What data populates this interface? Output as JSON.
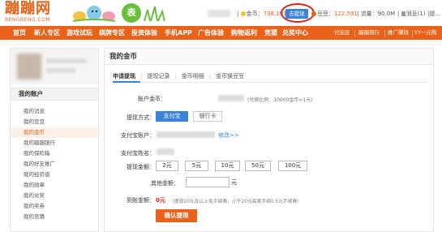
{
  "brand": {
    "name": "蹦蹦网",
    "domain": "BENGBENG.COM",
    "badge": "表"
  },
  "user_bar": {
    "coins_label": "金币：",
    "coins_value": "738,191",
    "withdraw_label": "去提现",
    "beans_label": "豆豆：",
    "beans_value": "122,591",
    "traffic_label": "流量：",
    "traffic_value": "90.0M",
    "message_label": "消息(1)",
    "separator": "|",
    "extra": "提..."
  },
  "nav": {
    "items": [
      "首页",
      "新人专区",
      "游戏试玩",
      "棋牌专区",
      "投资体验",
      "手机APP",
      "广告体验",
      "购物返利",
      "竞猜",
      "兑奖中心"
    ],
    "right_items": [
      "讨论区",
      "蹦蹦银行",
      "推广赚钱",
      "YY一元购"
    ]
  },
  "sidebar": {
    "title": "我的账户",
    "items": [
      "我的消息",
      "我的豆豆",
      "我的金币",
      "我的蹦蹦银行",
      "我的保险箱",
      "我的好友推广",
      "我的经验值",
      "我的勋章",
      "我的兑奖",
      "我的奖券",
      "我的竞猜"
    ],
    "active_index": 2
  },
  "main": {
    "title": "我的金币",
    "tabs": [
      "申请提现",
      "提现记录",
      "金币明细",
      "金币换豆豆"
    ],
    "active_tab": 0,
    "form": {
      "account_coins_label": "账户金币：",
      "ratio_note": "(兑换比例：10000金币=1元)",
      "method_label": "提现方式：",
      "methods": [
        "支付宝",
        "银行卡"
      ],
      "selected_method": 0,
      "alipay_account_label": "支付宝账户：",
      "modify_link": "修改>>",
      "alipay_name_label": "支付宝姓名：",
      "amount_label": "提现金额：",
      "amounts": [
        "2元",
        "5元",
        "10元",
        "50元",
        "100元"
      ],
      "other_amount_label": "其他金额：",
      "other_amount_value": "",
      "unit": "元",
      "arrival_label": "到账金额：",
      "arrival_value": "0元",
      "fee_note": "（提现20元及以上免手续费，小于20元每笔手续0.5元手续费）",
      "confirm_button": "确认提现"
    }
  },
  "colors": {
    "accent": "#e8621a",
    "blue": "#3b83d9",
    "highlight_circle": "#d9201a"
  }
}
